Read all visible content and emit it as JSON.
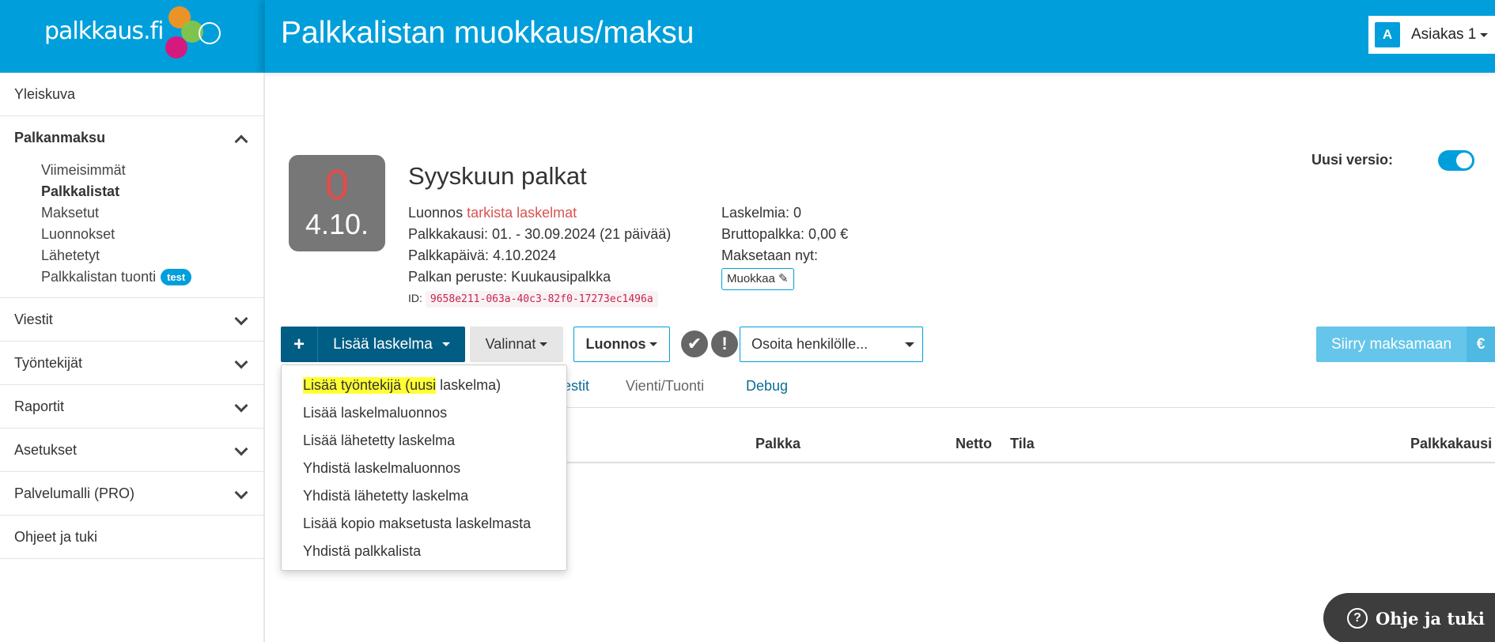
{
  "brand": {
    "logo_text": "palkkaus.fi",
    "accent": "#009fdb"
  },
  "header": {
    "title": "Palkkalistan muokkaus/maksu"
  },
  "user": {
    "avatar_letter": "A",
    "name": "Asiakas 1"
  },
  "sidebar": {
    "overview": "Yleiskuva",
    "payroll_group": {
      "label": "Palkanmaksu",
      "items": [
        "Viimeisimmät",
        "Palkkalistat",
        "Maksetut",
        "Luonnokset",
        "Lähetetyt",
        "Palkkalistan tuonti"
      ],
      "active": "Palkkalistat",
      "badge": "test"
    },
    "items": [
      "Viestit",
      "Työntekijät",
      "Raportit",
      "Asetukset",
      "Palvelumalli (PRO)"
    ],
    "help": "Ohjeet ja tuki"
  },
  "version": {
    "label": "Uusi versio:",
    "enabled": true
  },
  "run": {
    "tile_count": "0",
    "tile_date": "4.10.",
    "title": "Syyskuun palkat",
    "status": "Luonnos",
    "status_warning": "tarkista laskelmat",
    "period": "Palkkakausi: 01. - 30.09.2024 (21 päivää)",
    "payday": "Palkkapäivä: 4.10.2024",
    "basis": "Palkan peruste: Kuukausipalkka",
    "id_label": "ID:",
    "id_value": "9658e211-063a-40c3-82f0-17273ec1496a",
    "calc_count": "Laskelmia: 0",
    "gross": "Bruttopalkka: 0,00 €",
    "pay_now": "Maksetaan nyt:",
    "edit_label": "Muokkaa"
  },
  "toolbar": {
    "add_plus": "+",
    "add_label": "Lisää laskelma",
    "options_label": "Valinnat",
    "draft_label": "Luonnos",
    "check_icon": "✔",
    "alert_icon": "!",
    "assign_placeholder": "Osoita henkilölle...",
    "pay_label": "Siirry maksamaan",
    "pay_icon": "€"
  },
  "tabs": [
    "estit",
    "Vienti/Tuonti",
    "Debug"
  ],
  "table": {
    "columns": [
      "Palkka",
      "Netto",
      "Tila",
      "Palkkakausi"
    ]
  },
  "dropdown": {
    "first_highlight": "Lisää työntekijä (uusi",
    "first_rest": " laskelma)",
    "items": [
      "Lisää laskelmaluonnos",
      "Lisää lähetetty laskelma",
      "Yhdistä laskelmaluonnos",
      "Yhdistä lähetetty laskelma",
      "Lisää kopio maksetusta laskelmasta",
      "Yhdistä palkkalista"
    ]
  },
  "help_button": {
    "icon": "?",
    "label": "Ohje ja tuki"
  }
}
